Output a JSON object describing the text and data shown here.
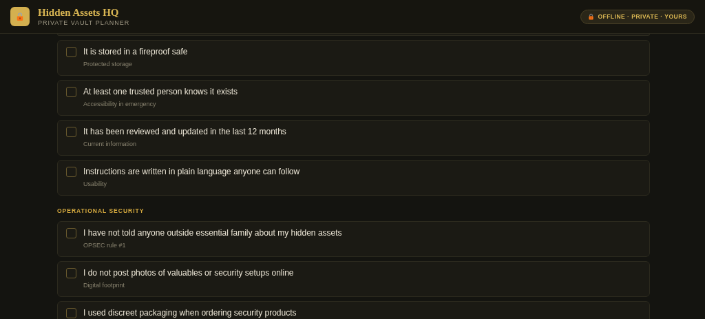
{
  "header": {
    "title": "Hidden Assets HQ",
    "subtitle": "PRIVATE VAULT PLANNER",
    "badge": "OFFLINE · PRIVATE · YOURS"
  },
  "sections": [
    {
      "items": [
        {
          "label": "It is stored in a fireproof safe",
          "note": "Protected storage",
          "checked": false
        },
        {
          "label": "At least one trusted person knows it exists",
          "note": "Accessibility in emergency",
          "checked": false
        },
        {
          "label": "It has been reviewed and updated in the last 12 months",
          "note": "Current information",
          "checked": false
        },
        {
          "label": "Instructions are written in plain language anyone can follow",
          "note": "Usability",
          "checked": false
        }
      ]
    },
    {
      "heading": "OPERATIONAL SECURITY",
      "items": [
        {
          "label": "I have not told anyone outside essential family about my hidden assets",
          "note": "OPSEC rule #1",
          "checked": false
        },
        {
          "label": "I do not post photos of valuables or security setups online",
          "note": "Digital footprint",
          "checked": false
        },
        {
          "label": "I used discreet packaging when ordering security products",
          "checked": false
        }
      ]
    }
  ]
}
